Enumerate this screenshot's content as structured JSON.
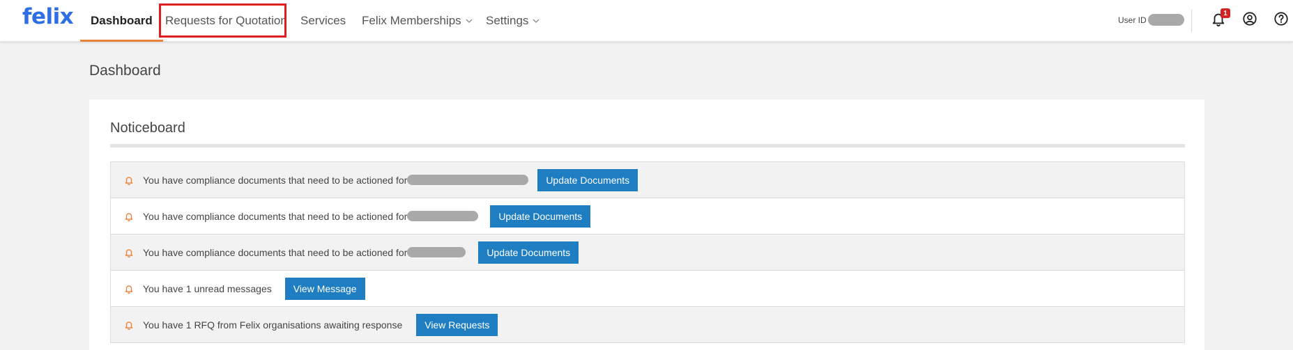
{
  "app": {
    "logo": "felix"
  },
  "nav": {
    "items": [
      {
        "label": "Dashboard"
      },
      {
        "label": "Requests for Quotation"
      },
      {
        "label": "Services"
      },
      {
        "label": "Felix Memberships"
      },
      {
        "label": "Settings"
      }
    ]
  },
  "header": {
    "user_id_label": "User ID",
    "notification_count": "1",
    "icons": [
      "bell-icon",
      "user-circle-icon",
      "help-circle-icon"
    ]
  },
  "page": {
    "title": "Dashboard"
  },
  "noticeboard": {
    "title": "Noticeboard",
    "notices": [
      {
        "text": "You have compliance documents that need to be actioned for",
        "button": "Update Documents"
      },
      {
        "text": "You have compliance documents that need to be actioned for",
        "button": "Update Documents"
      },
      {
        "text": "You have compliance documents that need to be actioned for",
        "button": "Update Documents"
      },
      {
        "text": "You have 1 unread messages",
        "button": "View Message"
      },
      {
        "text": "You have 1 RFQ from Felix organisations awaiting response",
        "button": "View Requests"
      }
    ]
  },
  "colors": {
    "brand": "#2f6fe4",
    "active_underline": "#e8833a",
    "button": "#1f7dc1",
    "bell": "#e8833a",
    "badge": "#d32323",
    "highlight": "#e01e1e"
  }
}
